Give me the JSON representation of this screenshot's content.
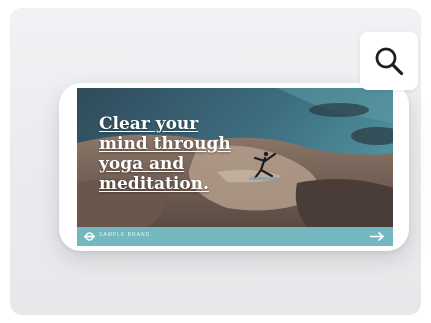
{
  "preview": {
    "headline_lines": [
      "Clear your",
      "mind through",
      "yoga and",
      "meditation."
    ],
    "footer_brand": "SAMPLE BRAND",
    "footer_color": "#73b8be",
    "arrow_icon": "arrow-right-icon"
  },
  "zoom_button": {
    "icon": "search-icon"
  }
}
